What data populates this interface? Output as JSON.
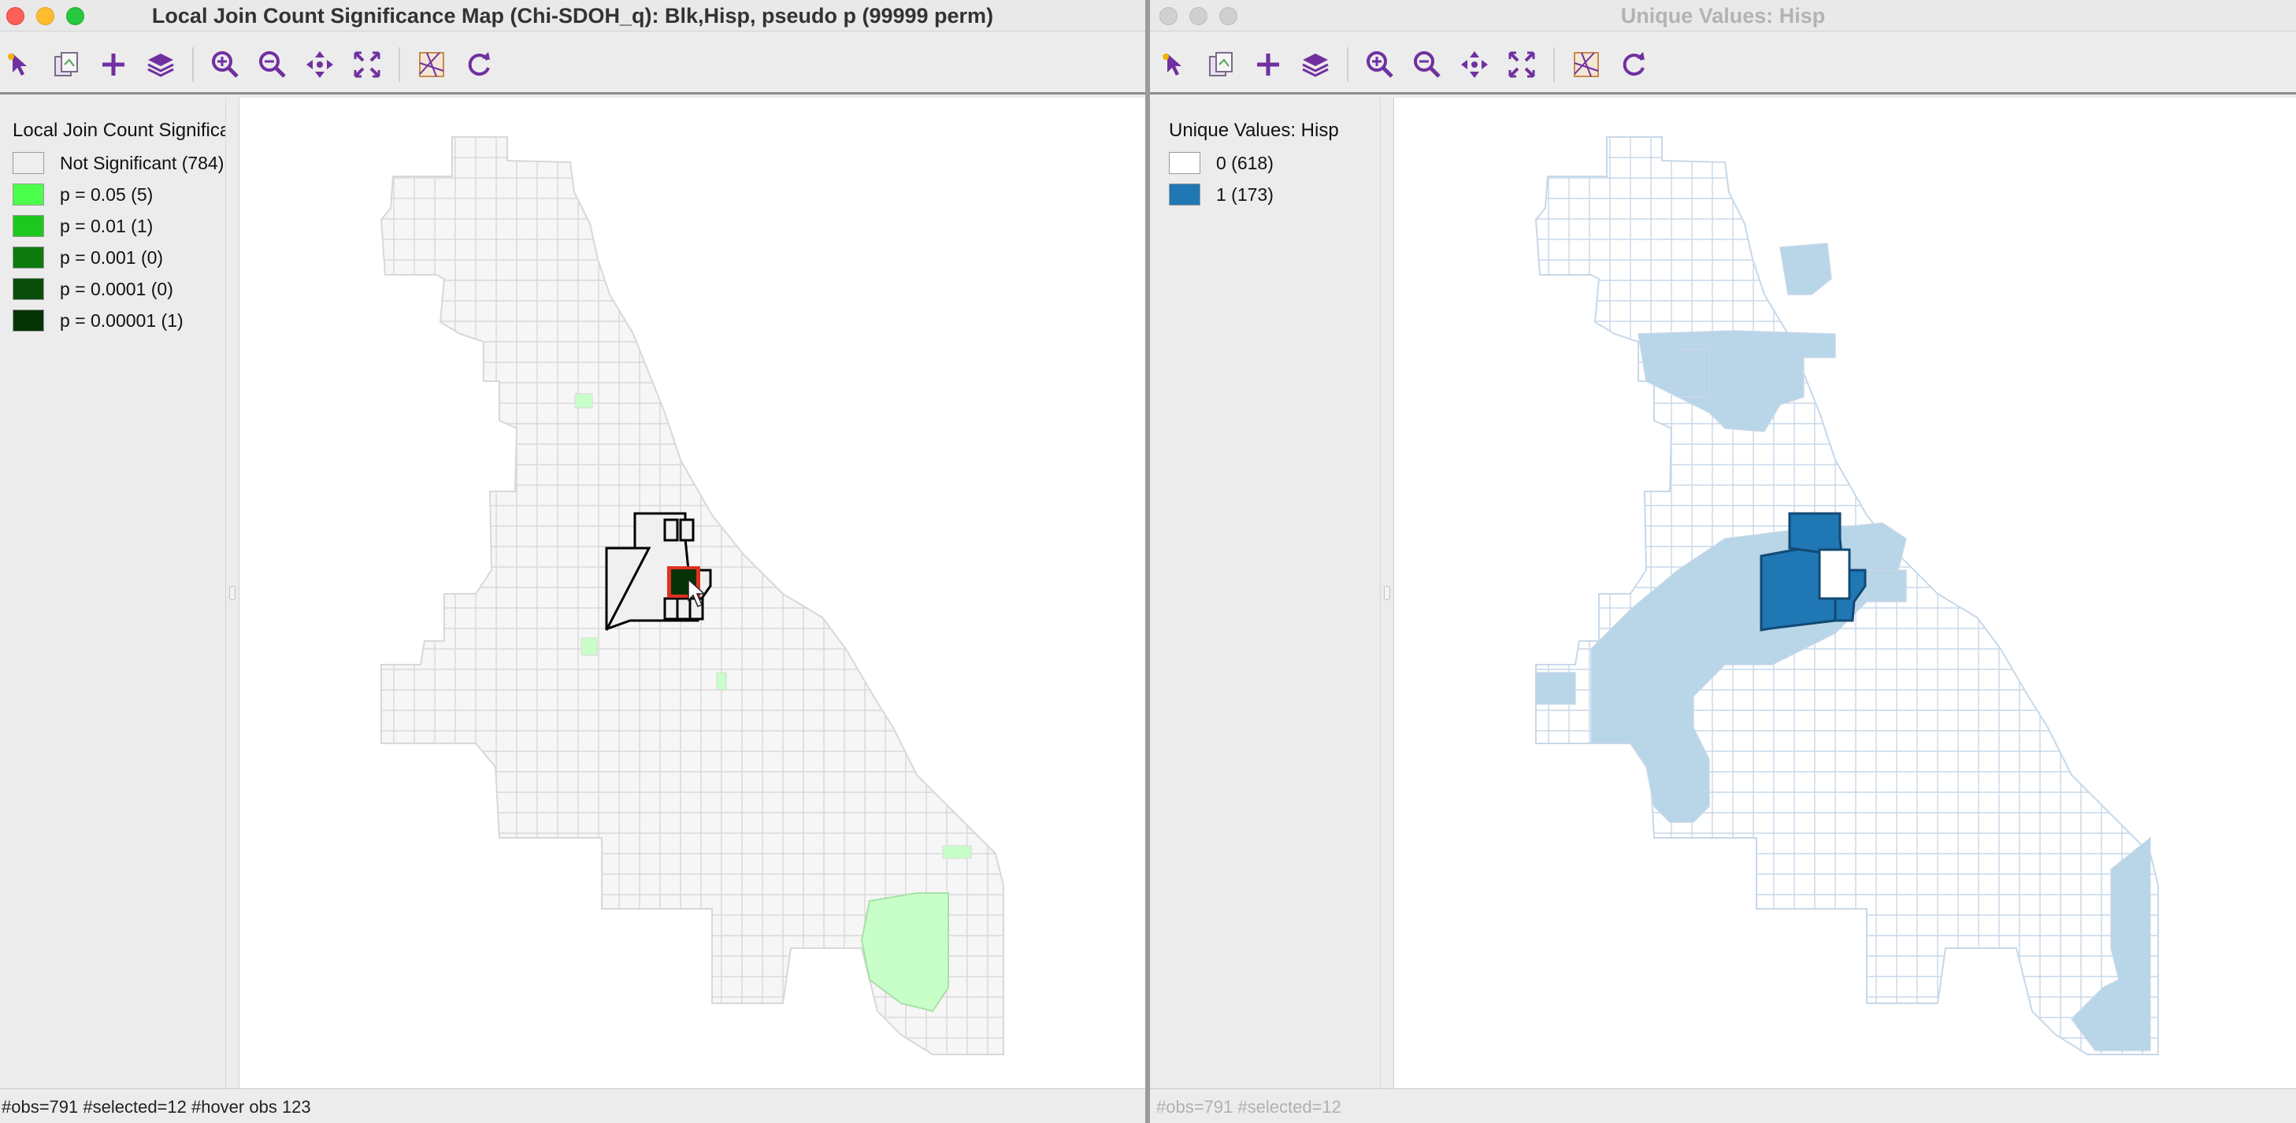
{
  "left_window": {
    "title": "Local Join Count Significance Map (Chi-SDOH_q): Blk,Hisp, pseudo p (99999 perm)",
    "legend": {
      "title": "Local Join Count Significance",
      "items": [
        {
          "label": "Not Significant (784)",
          "color": "#eeeeee"
        },
        {
          "label": "p = 0.05 (5)",
          "color": "#4dff4d"
        },
        {
          "label": "p = 0.01 (1)",
          "color": "#1ec71e"
        },
        {
          "label": "p = 0.001 (0)",
          "color": "#0d7a0d"
        },
        {
          "label": "p = 0.0001 (0)",
          "color": "#0a4d0a"
        },
        {
          "label": "p = 0.00001 (1)",
          "color": "#063306"
        }
      ]
    },
    "status": "#obs=791 #selected=12  #hover obs 123"
  },
  "right_window": {
    "title": "Unique Values: Hisp",
    "legend": {
      "title": "Unique Values: Hisp",
      "items": [
        {
          "label": "0 (618)",
          "color": "#ffffff"
        },
        {
          "label": "1 (173)",
          "color": "#1f77b4"
        }
      ]
    },
    "status": "#obs=791 #selected=12"
  },
  "toolbar_icons": [
    "select-arrow-icon",
    "copy-image-icon",
    "add-layer-icon",
    "layers-icon",
    "zoom-in-icon",
    "zoom-out-icon",
    "pan-icon",
    "fit-extent-icon",
    "basemap-icon",
    "refresh-icon"
  ],
  "colors": {
    "title_active": "#333333",
    "title_inactive": "#b3b3b3",
    "toolbar_accent": "#7030a0",
    "map_outline_left": "#d8d8d8",
    "map_outline_right": "#c7d8e8",
    "hisp_light": "#b9d5e8",
    "hisp_dark": "#1f77b4",
    "sig_light": "#c8ffc8",
    "selection_border": "#000000",
    "hover_border": "#e03020"
  }
}
